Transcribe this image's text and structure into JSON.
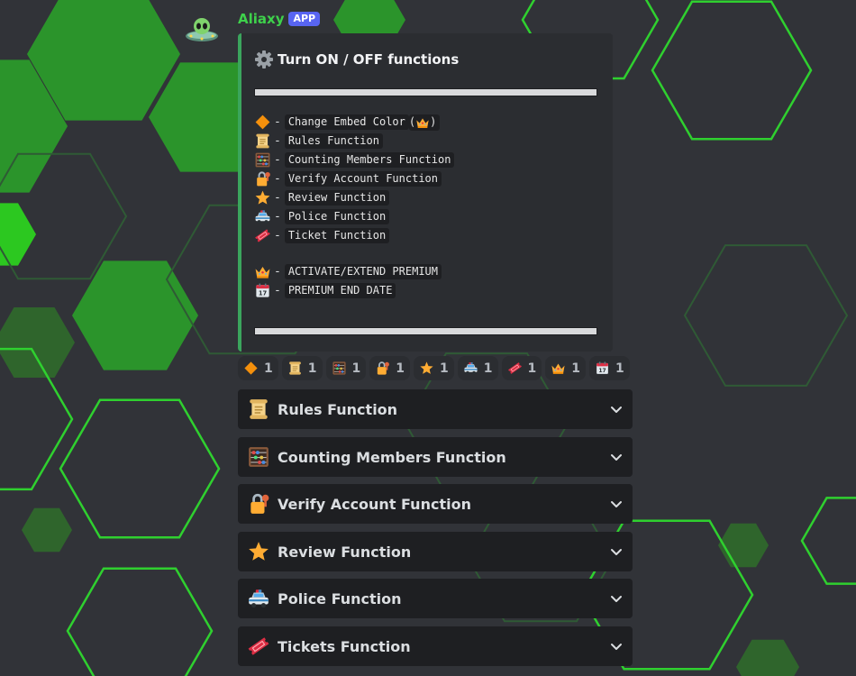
{
  "message": {
    "username": "Aliaxy",
    "badge": "APP"
  },
  "embed": {
    "title": "Turn ON / OFF functions",
    "functions": [
      {
        "icon": "diamond-icon",
        "label": "Change Embed Color",
        "premium": true
      },
      {
        "icon": "scroll-icon",
        "label": "Rules Function"
      },
      {
        "icon": "abacus-icon",
        "label": "Counting Members Function"
      },
      {
        "icon": "lock-key-icon",
        "label": "Verify Account Function"
      },
      {
        "icon": "star-icon",
        "label": "Review Function"
      },
      {
        "icon": "police-car-icon",
        "label": "Police Function"
      },
      {
        "icon": "ticket-icon",
        "label": "Ticket Function"
      }
    ],
    "premium_lines": [
      {
        "icon": "crown-icon",
        "label": "ACTIVATE/EXTEND PREMIUM"
      },
      {
        "icon": "calendar-icon",
        "label": "PREMIUM END DATE"
      }
    ],
    "dash": "-"
  },
  "reactions": [
    {
      "icon": "diamond-icon",
      "count": "1"
    },
    {
      "icon": "scroll-icon",
      "count": "1"
    },
    {
      "icon": "abacus-icon",
      "count": "1"
    },
    {
      "icon": "lock-key-icon",
      "count": "1"
    },
    {
      "icon": "star-icon",
      "count": "1"
    },
    {
      "icon": "police-car-icon",
      "count": "1"
    },
    {
      "icon": "ticket-icon",
      "count": "1"
    },
    {
      "icon": "crown-icon",
      "count": "1"
    },
    {
      "icon": "calendar-icon",
      "count": "1"
    }
  ],
  "dropdowns": [
    {
      "icon": "scroll-icon",
      "label": "Rules Function"
    },
    {
      "icon": "abacus-icon",
      "label": "Counting Members Function"
    },
    {
      "icon": "lock-key-icon",
      "label": "Verify Account Function"
    },
    {
      "icon": "star-icon",
      "label": "Review Function"
    },
    {
      "icon": "police-car-icon",
      "label": "Police Function"
    },
    {
      "icon": "ticket-icon",
      "label": "Tickets Function"
    }
  ],
  "colors": {
    "background": "#313338",
    "username": "#3ed14b",
    "badge": "#5865f2",
    "embed_border": "#3ba55d",
    "hex_green": "#2fbf2f"
  }
}
